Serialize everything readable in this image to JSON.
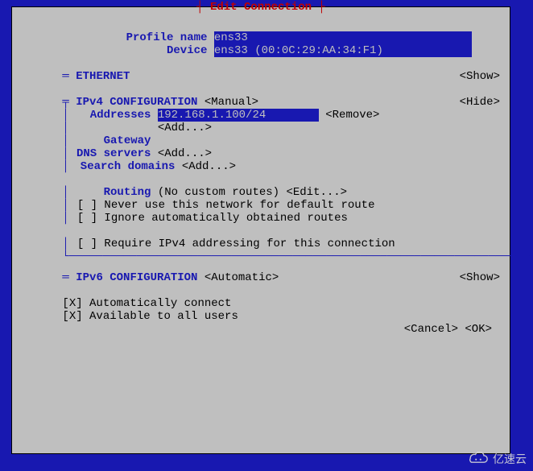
{
  "title": "┤ Edit Connection ├",
  "profile": {
    "name_label": "Profile name",
    "name_value": "ens33",
    "device_label": "Device",
    "device_value": "ens33 (00:0C:29:AA:34:F1)"
  },
  "ethernet": {
    "marker": "═",
    "label": "ETHERNET",
    "show": "<Show>"
  },
  "ipv4": {
    "marker": "╤",
    "label": "IPv4 CONFIGURATION",
    "mode": "<Manual>",
    "hide": "<Hide>",
    "addresses_label": "Addresses",
    "address_value": "192.168.1.100/24",
    "remove": "<Remove>",
    "add": "<Add...>",
    "gateway_label": "Gateway",
    "gateway_value": "",
    "dns_label": "DNS servers",
    "dns_add": "<Add...>",
    "search_label": "Search domains",
    "search_add": "<Add...>",
    "routing_label": "Routing",
    "routing_value": "(No custom routes)",
    "routing_edit": "<Edit...>",
    "never_default": "[ ] Never use this network for default route",
    "ignore_routes": "[ ] Ignore automatically obtained routes",
    "require_ipv4": "[ ] Require IPv4 addressing for this connection"
  },
  "ipv6": {
    "marker": "═",
    "label": "IPv6 CONFIGURATION",
    "mode": "<Automatic>",
    "show": "<Show>"
  },
  "options": {
    "auto_connect": "[X] Automatically connect",
    "all_users": "[X] Available to all users"
  },
  "footer": {
    "cancel": "<Cancel>",
    "ok": "<OK>"
  },
  "watermark": "亿速云"
}
